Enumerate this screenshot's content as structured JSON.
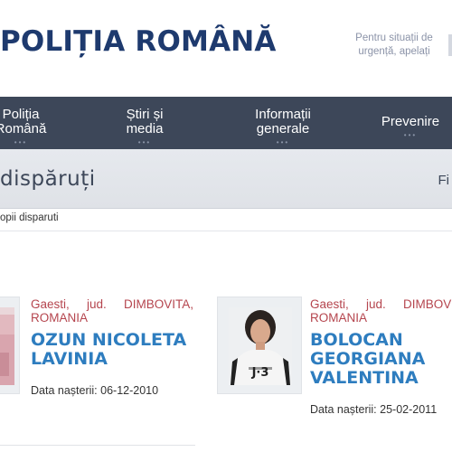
{
  "header": {
    "title": "POLIȚIA ROMÂNĂ",
    "emergency_text": "Pentru situații de urgență, apelați"
  },
  "nav": {
    "items": [
      {
        "label": "Poliția Română"
      },
      {
        "label": "Știri și media"
      },
      {
        "label": "Informații generale"
      },
      {
        "label": "Prevenire"
      }
    ],
    "dots": "•••"
  },
  "section": {
    "title": "dispăruți",
    "filter_label": "Fi"
  },
  "breadcrumb": "opii disparuti",
  "children": [
    {
      "location_line1": "Gaesti, jud. DIMBOVITA,",
      "location_line2": "ROMANIA",
      "name": "OZUN NICOLETA LAVINIA",
      "dob_label": "Data nașterii:",
      "dob": "06-12-2010"
    },
    {
      "location_line1": "Gaesti, jud. DIMBOVITA,",
      "location_line2": "ROMANIA",
      "name": "BOLOCAN GEORGIANA VALENTINA",
      "dob_label": "Data nașterii:",
      "dob": "25-02-2011",
      "shirt_text": "J·3"
    }
  ]
}
